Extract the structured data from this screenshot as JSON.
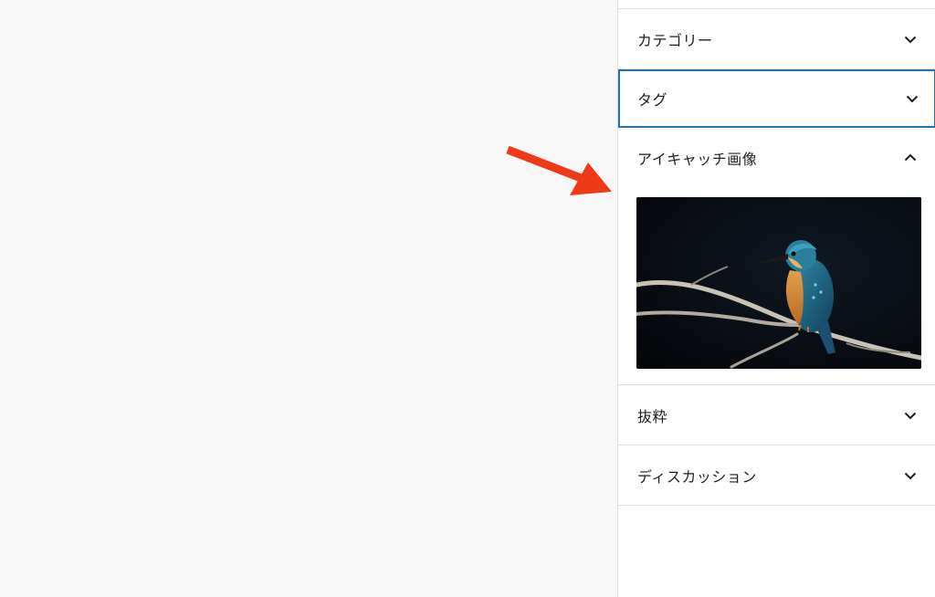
{
  "sidebar": {
    "panels": [
      {
        "title": "カテゴリー",
        "state": "collapsed",
        "icon": "chevron-down-icon"
      },
      {
        "title": "タグ",
        "state": "collapsed",
        "icon": "chevron-down-icon"
      },
      {
        "title": "アイキャッチ画像",
        "state": "expanded",
        "icon": "chevron-up-icon"
      },
      {
        "title": "抜粋",
        "state": "collapsed",
        "icon": "chevron-down-icon"
      },
      {
        "title": "ディスカッション",
        "state": "collapsed",
        "icon": "chevron-down-icon"
      }
    ],
    "featured_image": {
      "subject": "kingfisher-on-branch"
    }
  },
  "annotation": {
    "arrow_color": "#f03a17"
  },
  "colors": {
    "focus": "#2271b1",
    "border": "#e0e0e0",
    "canvas": "#f8f8f8"
  }
}
